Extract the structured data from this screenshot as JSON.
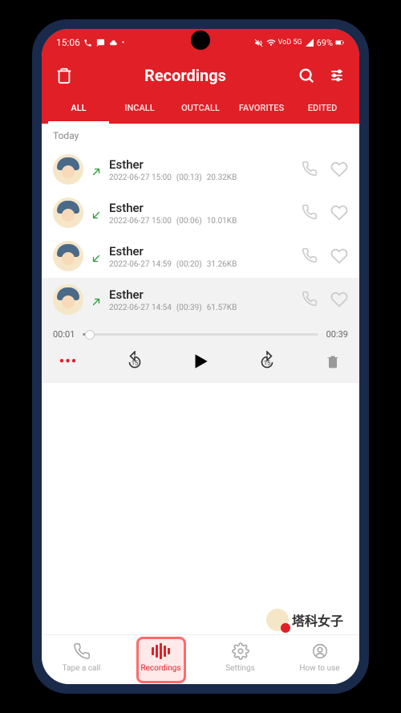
{
  "status_bar": {
    "time": "15:06",
    "network_label": "VoD 5G",
    "battery_percent": "69%"
  },
  "header": {
    "title": "Recordings"
  },
  "tabs": [
    {
      "label": "ALL",
      "active": true
    },
    {
      "label": "INCALL",
      "active": false
    },
    {
      "label": "OUTCALL",
      "active": false
    },
    {
      "label": "FAVORITES",
      "active": false
    },
    {
      "label": "EDITED",
      "active": false
    }
  ],
  "section_label": "Today",
  "recordings": [
    {
      "name": "Esther",
      "direction": "out",
      "date": "2022-06-27 15:00",
      "duration": "(00:13)",
      "size": "20.32KB",
      "expanded": false
    },
    {
      "name": "Esther",
      "direction": "in",
      "date": "2022-06-27 15:00",
      "duration": "(00:06)",
      "size": "10.01KB",
      "expanded": false
    },
    {
      "name": "Esther",
      "direction": "in",
      "date": "2022-06-27 14:59",
      "duration": "(00:20)",
      "size": "31.26KB",
      "expanded": false
    },
    {
      "name": "Esther",
      "direction": "out",
      "date": "2022-06-27 14:54",
      "duration": "(00:39)",
      "size": "61.57KB",
      "expanded": true
    }
  ],
  "player": {
    "current_time": "00:01",
    "total_time": "00:39",
    "progress_percent": 3
  },
  "bottom_nav": [
    {
      "label": "Tape a call",
      "icon": "phone",
      "active": false,
      "highlighted": false
    },
    {
      "label": "Recordings",
      "icon": "waveform",
      "active": true,
      "highlighted": true
    },
    {
      "label": "Settings",
      "icon": "gear",
      "active": false,
      "highlighted": false
    },
    {
      "label": "How to use",
      "icon": "user",
      "active": false,
      "highlighted": false
    }
  ],
  "watermark_text": "塔科女子",
  "colors": {
    "brand": "#e01f26"
  }
}
